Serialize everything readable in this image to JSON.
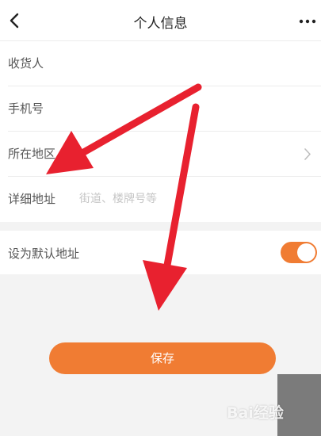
{
  "header": {
    "title": "个人信息",
    "back_icon": "chevron-left-icon",
    "more_icon": "more-dots-icon"
  },
  "form": {
    "rows": [
      {
        "label": "收货人",
        "value": "",
        "placeholder": ""
      },
      {
        "label": "手机号",
        "value": "",
        "placeholder": ""
      },
      {
        "label": "所在地区",
        "value": "",
        "placeholder": "",
        "icon": "chevron-right-icon"
      },
      {
        "label": "详细地址",
        "value": "",
        "placeholder": "街道、楼牌号等"
      }
    ]
  },
  "default_address": {
    "label": "设为默认地址",
    "enabled": true
  },
  "save_label": "保存",
  "watermark": "Bai经验",
  "colors": {
    "accent": "#f07c33",
    "annotation_arrow": "#e8212f",
    "background": "#f3f3f3"
  }
}
